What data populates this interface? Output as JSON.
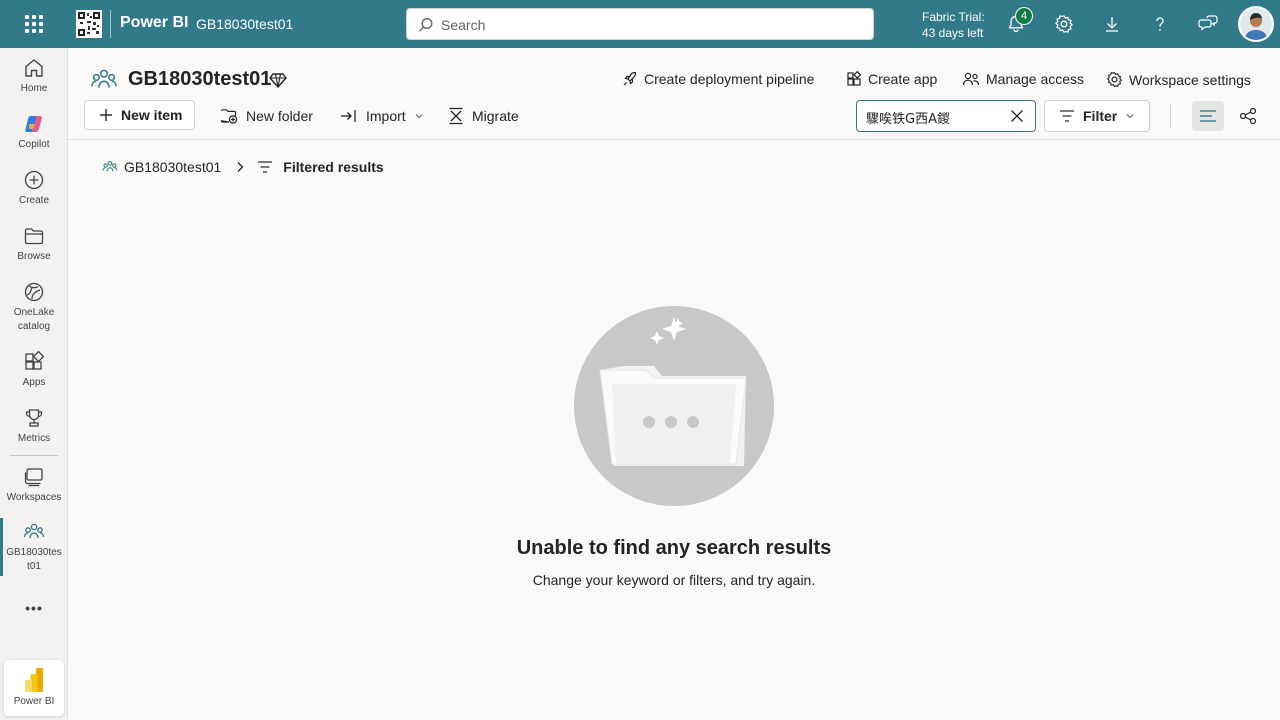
{
  "topbar": {
    "brand": "Power BI",
    "workspace": "GB18030test01",
    "search_placeholder": "Search",
    "trial_line1": "Fabric Trial:",
    "trial_line2": "43 days left",
    "notifications_count": "4"
  },
  "rail": {
    "home": "Home",
    "copilot": "Copilot",
    "create": "Create",
    "browse": "Browse",
    "onelake_1": "OneLake",
    "onelake_2": "catalog",
    "apps": "Apps",
    "metrics": "Metrics",
    "workspaces": "Workspaces",
    "active_ws_1": "GB18030tes",
    "active_ws_2": "t01",
    "more": "•••",
    "powerbi": "Power BI"
  },
  "header": {
    "workspace_name": "GB18030test01",
    "create_pipeline": "Create deployment pipeline",
    "create_app": "Create app",
    "manage_access": "Manage access",
    "workspace_settings": "Workspace settings"
  },
  "toolbar": {
    "new_item": "New item",
    "new_folder": "New folder",
    "import": "Import",
    "migrate": "Migrate",
    "filter_value": "驟唉铁G西A鍐",
    "filter_label": "Filter"
  },
  "breadcrumb": {
    "workspace": "GB18030test01",
    "current": "Filtered results"
  },
  "empty_state": {
    "title": "Unable to find any search results",
    "subtitle": "Change your keyword or filters, and try again."
  },
  "colors": {
    "topbar": "#327a8a",
    "accent": "#327a8a"
  }
}
